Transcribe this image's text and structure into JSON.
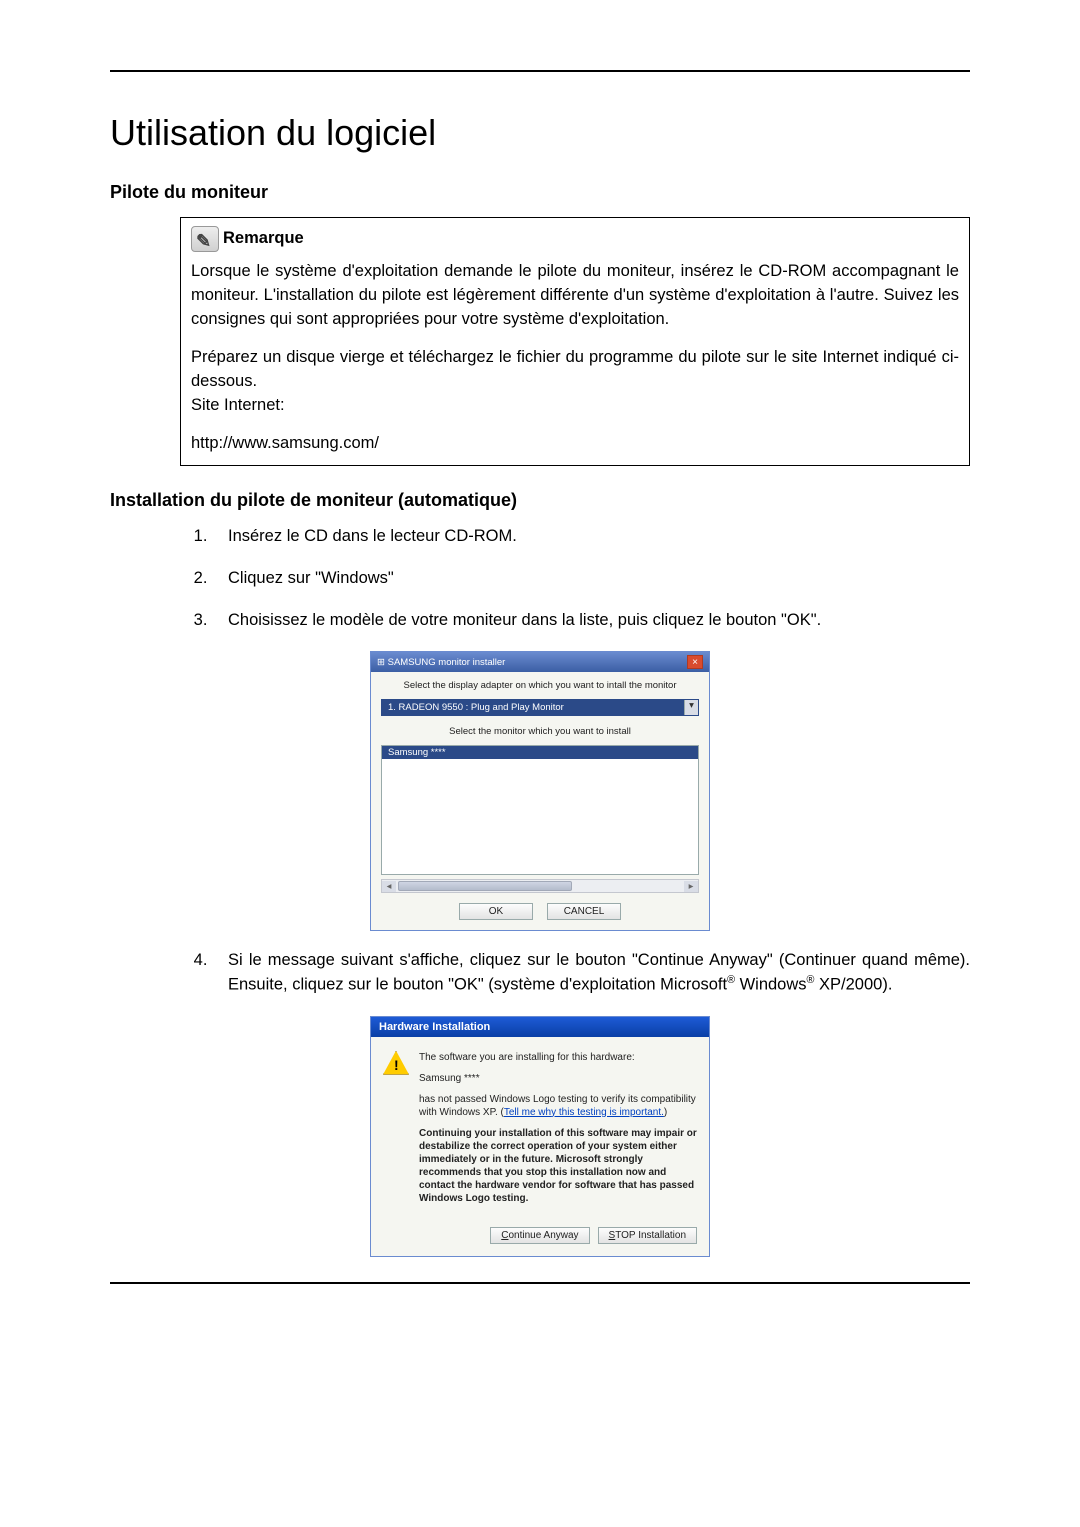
{
  "page": {
    "title": "Utilisation du logiciel",
    "section1": "Pilote du moniteur",
    "note": {
      "label": "Remarque",
      "p1": "Lorsque le système d'exploitation demande le pilote du moniteur, insérez le CD-ROM accompagnant le moniteur. L'installation du pilote est légèrement différente d'un système d'exploitation à l'autre. Suivez les consignes qui sont appropriées pour votre système d'exploitation.",
      "p2": "Préparez un disque vierge et téléchargez le fichier du programme du pilote sur le site Internet indiqué ci-dessous.",
      "site_label": "Site Internet:",
      "site_url": "http://www.samsung.com/"
    },
    "section2": "Installation du pilote de moniteur (automatique)",
    "steps": {
      "s1": "Insérez le CD dans le lecteur CD-ROM.",
      "s2": "Cliquez sur \"Windows\"",
      "s3": "Choisissez le modèle de votre moniteur dans la liste, puis cliquez le bouton \"OK\".",
      "s4_a": "Si le message suivant s'affiche, cliquez sur le bouton \"Continue Anyway\" (Continuer quand même). Ensuite, cliquez sur le bouton \"OK\" (système d'exploitation Microsoft",
      "s4_b": " Windows",
      "s4_c": " XP/2000)."
    }
  },
  "dlg1": {
    "title": "SAMSUNG monitor installer",
    "line1": "Select the display adapter on which you want to intall the monitor",
    "combo": "1. RADEON 9550 : Plug and Play Monitor",
    "line2": "Select the monitor which you want to install",
    "list_item": "Samsung ****",
    "ok": "OK",
    "cancel": "CANCEL"
  },
  "dlg2": {
    "title": "Hardware Installation",
    "p1": "The software you are installing for this hardware:",
    "p2": "Samsung ****",
    "p3a": "has not passed Windows Logo testing to verify its compatibility with Windows XP. (",
    "p3_link": "Tell me why this testing is important.",
    "p3b": ")",
    "p4": "Continuing your installation of this software may impair or destabilize the correct operation of your system either immediately or in the future. Microsoft strongly recommends that you stop this installation now and contact the hardware vendor for software that has passed Windows Logo testing.",
    "btn_continue_u": "C",
    "btn_continue_rest": "ontinue Anyway",
    "btn_stop_u": "S",
    "btn_stop_rest": "TOP Installation"
  }
}
